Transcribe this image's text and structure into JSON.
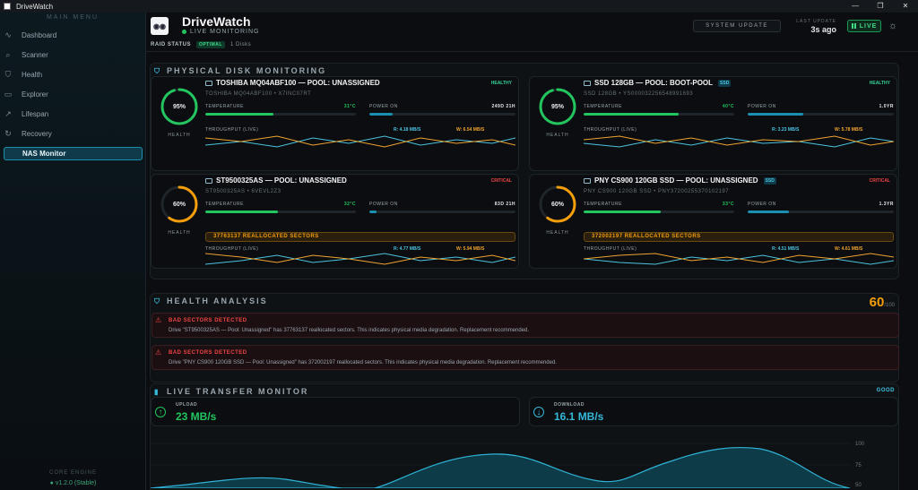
{
  "window": {
    "title": "DriveWatch"
  },
  "sidebar": {
    "menu_title": "MAIN MENU",
    "items": [
      {
        "label": "Dashboard",
        "icon": "pulse-icon"
      },
      {
        "label": "Scanner",
        "icon": "search-icon"
      },
      {
        "label": "Health",
        "icon": "shield-icon"
      },
      {
        "label": "Explorer",
        "icon": "drive-icon"
      },
      {
        "label": "Lifespan",
        "icon": "chart-line-icon"
      },
      {
        "label": "Recovery",
        "icon": "refresh-icon"
      },
      {
        "label": "NAS Monitor",
        "icon": "server-icon",
        "active": true
      }
    ],
    "core_engine": "CORE ENGINE",
    "version": "v1.2.0 (Stable)"
  },
  "header": {
    "title": "DriveWatch",
    "subtitle": "LIVE MONITORING",
    "system_update": "SYSTEM UPDATE",
    "last_update_label": "LAST UPDATE",
    "last_update_value": "3s ago",
    "live": "LIVE",
    "raid_status_label": "RAID STATUS",
    "raid_status_value": "OPTIMAL",
    "disk_count": "1 Disks"
  },
  "disk_monitoring": {
    "title": "PHYSICAL DISK MONITORING",
    "labels": {
      "health": "HEALTH",
      "temperature": "TEMPERATURE",
      "power_on": "POWER ON",
      "throughput": "THROUGHPUT (LIVE)"
    },
    "disks": [
      {
        "name": "TOSHIBA MQ04ABF100 — POOL: UNASSIGNED",
        "model": "TOSHIBA MQ04ABF100 • X7INC07RT",
        "status": "HEALTHY",
        "health": 95,
        "temp": "31°C",
        "temp_pct": 45,
        "power_on": "249D 21H",
        "power_pct": 16,
        "read": "R: 4.18 MB/S",
        "write": "W: 6.54 MB/S",
        "ssd": false,
        "alert": "",
        "color": "#22c55e"
      },
      {
        "name": "SSD 128GB — POOL: BOOT-POOL",
        "model": "SSD 128GB • YS000032256548991693",
        "status": "HEALTHY",
        "health": 95,
        "temp": "40°C",
        "temp_pct": 63,
        "power_on": "1.0YR",
        "power_pct": 38,
        "read": "R: 3.23 MB/S",
        "write": "W: 5.78 MB/S",
        "ssd": true,
        "ssd_label": "SSD",
        "alert": "",
        "color": "#22c55e"
      },
      {
        "name": "ST9500325AS — POOL: UNASSIGNED",
        "model": "ST9500325AS • 6VEVL2Z3",
        "status": "CRITICAL",
        "health": 60,
        "temp": "32°C",
        "temp_pct": 48,
        "power_on": "83D 21H",
        "power_pct": 5,
        "read": "R: 4.77 MB/S",
        "write": "W: 5.94 MB/S",
        "ssd": false,
        "alert": "37763137 REALLOCATED SECTORS",
        "color": "#f59e0b"
      },
      {
        "name": "PNY CS900 120GB SSD — POOL: UNASSIGNED",
        "model": "PNY CS900 120GB SSD • PNY37200255370102197",
        "status": "CRITICAL",
        "health": 60,
        "temp": "33°C",
        "temp_pct": 51,
        "power_on": "1.3YR",
        "power_pct": 28,
        "read": "R: 4.51 MB/S",
        "write": "W: 4.61 MB/S",
        "ssd": true,
        "ssd_label": "SSD",
        "alert": "372002197 REALLOCATED SECTORS",
        "color": "#f59e0b"
      }
    ]
  },
  "health_analysis": {
    "title": "HEALTH ANALYSIS",
    "score": "60",
    "score_max": "/100",
    "alerts": [
      {
        "title": "BAD SECTORS DETECTED",
        "detail": "Drive \"ST9500325AS — Pool: Unassigned\" has 37763137 reallocated sectors. This indicates physical media degradation. Replacement recommended."
      },
      {
        "title": "BAD SECTORS DETECTED",
        "detail": "Drive \"PNY CS900 120GB SSD — Pool: Unassigned\" has 372002197 reallocated sectors. This indicates physical media degradation. Replacement recommended."
      }
    ]
  },
  "transfer": {
    "title": "LIVE TRANSFER MONITOR",
    "status": "GOOD",
    "upload_label": "UPLOAD",
    "upload_value": "23 MB/s",
    "download_label": "DOWNLOAD",
    "download_value": "16.1 MB/s",
    "y_ticks": [
      "100",
      "75",
      "50"
    ]
  },
  "colors": {
    "accent": "#36b8d8",
    "healthy": "#22c55e",
    "warning": "#f59e0b",
    "critical": "#ef4444",
    "read": "#4cc3e0",
    "write": "#f0a430"
  }
}
